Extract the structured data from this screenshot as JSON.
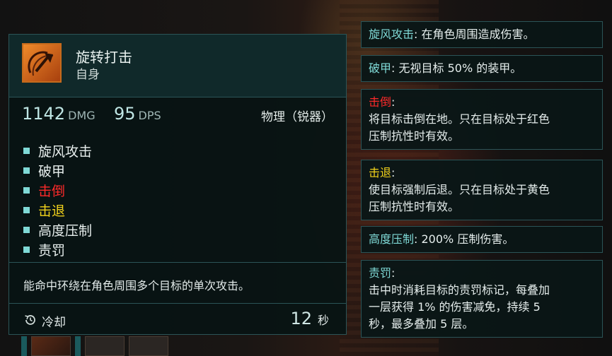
{
  "ability": {
    "name": "旋转打击",
    "target": "自身",
    "damage_value": "1142",
    "damage_unit": "DMG",
    "dps_value": "95",
    "dps_unit": "DPS",
    "damage_type": "物理（锐器）",
    "keywords": [
      {
        "label": "旋风攻击",
        "color": "#e8efee"
      },
      {
        "label": "破甲",
        "color": "#e8efee"
      },
      {
        "label": "击倒",
        "color": "#ff2a2a"
      },
      {
        "label": "击退",
        "color": "#f2d21b"
      },
      {
        "label": "高度压制",
        "color": "#e8efee"
      },
      {
        "label": "责罚",
        "color": "#e8efee"
      }
    ],
    "description": "能命中环绕在角色周围多个目标的单次攻击。",
    "cooldown_label": "冷却",
    "cooldown_value": "12",
    "cooldown_unit": "秒",
    "icon": "axe-swing-icon"
  },
  "keyword_panels": [
    {
      "term": "旋风攻击",
      "sep": ": ",
      "text": "在角色周围造成伤害。",
      "term_color": "#7fd9d6"
    },
    {
      "term": "破甲",
      "sep": ": ",
      "text": "无视目标 50% 的装甲。",
      "term_color": "#7fd9d6"
    },
    {
      "term": "击倒",
      "sep": ":",
      "lines": [
        "将目标击倒在地。只在目标处于红色",
        "压制抗性时有效。"
      ],
      "term_color": "#ff2a2a"
    },
    {
      "term": "击退",
      "sep": ":",
      "lines": [
        "使目标强制后退。只在目标处于黄色",
        "压制抗性时有效。"
      ],
      "term_color": "#f2d21b"
    },
    {
      "term": "高度压制",
      "sep": ": ",
      "text": "200% 压制伤害。",
      "term_color": "#7fd9d6"
    },
    {
      "term": "责罚",
      "sep": ":",
      "lines": [
        "击中时消耗目标的责罚标记，每叠加",
        "一层获得 1% 的伤害减免，持续 5",
        "秒，最多叠加 5 层。"
      ],
      "term_color": "#7fd9d6"
    }
  ],
  "colors": {
    "accent": "#7fd9d6",
    "border": "#2b5457",
    "panel_bg": "#081414",
    "knockdown": "#ff2a2a",
    "knockback": "#f2d21b"
  }
}
